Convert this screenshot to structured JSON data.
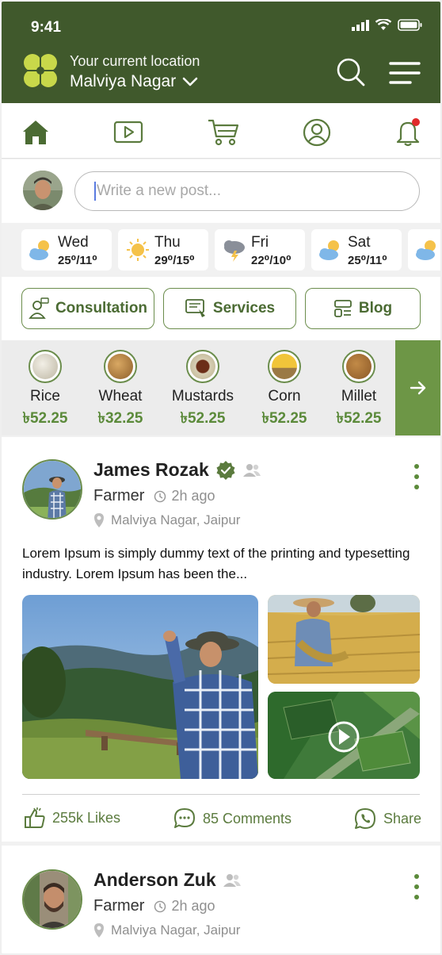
{
  "status": {
    "time": "9:41"
  },
  "header": {
    "location_label": "Your current location",
    "location_value": "Malviya Nagar"
  },
  "nav": {
    "icons": [
      "home-icon",
      "video-icon",
      "cart-icon",
      "profile-icon",
      "notification-bell-icon"
    ]
  },
  "composer": {
    "placeholder": "Write a new post..."
  },
  "weather": [
    {
      "day": "Wed",
      "temp": "25⁰/11⁰",
      "icon": "partly-cloudy-icon"
    },
    {
      "day": "Thu",
      "temp": "29⁰/15⁰",
      "icon": "sun-icon"
    },
    {
      "day": "Fri",
      "temp": "22⁰/10⁰",
      "icon": "thunderstorm-icon"
    },
    {
      "day": "Sat",
      "temp": "25⁰/11⁰",
      "icon": "partly-cloudy-icon"
    }
  ],
  "pills": {
    "consultation": "Consultation",
    "services": "Services",
    "blog": "Blog"
  },
  "commodities": [
    {
      "name": "Rice",
      "price": "৳52.25",
      "color": "#d9d3c3"
    },
    {
      "name": "Wheat",
      "price": "৳32.25",
      "color": "#b9853f"
    },
    {
      "name": "Mustards",
      "price": "৳52.25",
      "color": "#7a3d22"
    },
    {
      "name": "Corn",
      "price": "৳52.25",
      "color": "#e7b62b"
    },
    {
      "name": "Millet",
      "price": "৳52.25",
      "color": "#a8733a"
    }
  ],
  "posts": [
    {
      "name": "James Rozak",
      "role": "Farmer",
      "time": "2h ago",
      "location": "Malviya Nagar, Jaipur",
      "text": "Lorem Ipsum is simply dummy text of the printing and typesetting industry. Lorem Ipsum has been the...",
      "likes": "255k Likes",
      "comments": "85 Comments",
      "share": "Share"
    },
    {
      "name": "Anderson Zuk",
      "role": "Farmer",
      "time": "2h ago",
      "location": "Malviya Nagar, Jaipur"
    }
  ],
  "colors": {
    "brand": "#40592c",
    "accent": "#5b8a3a"
  }
}
